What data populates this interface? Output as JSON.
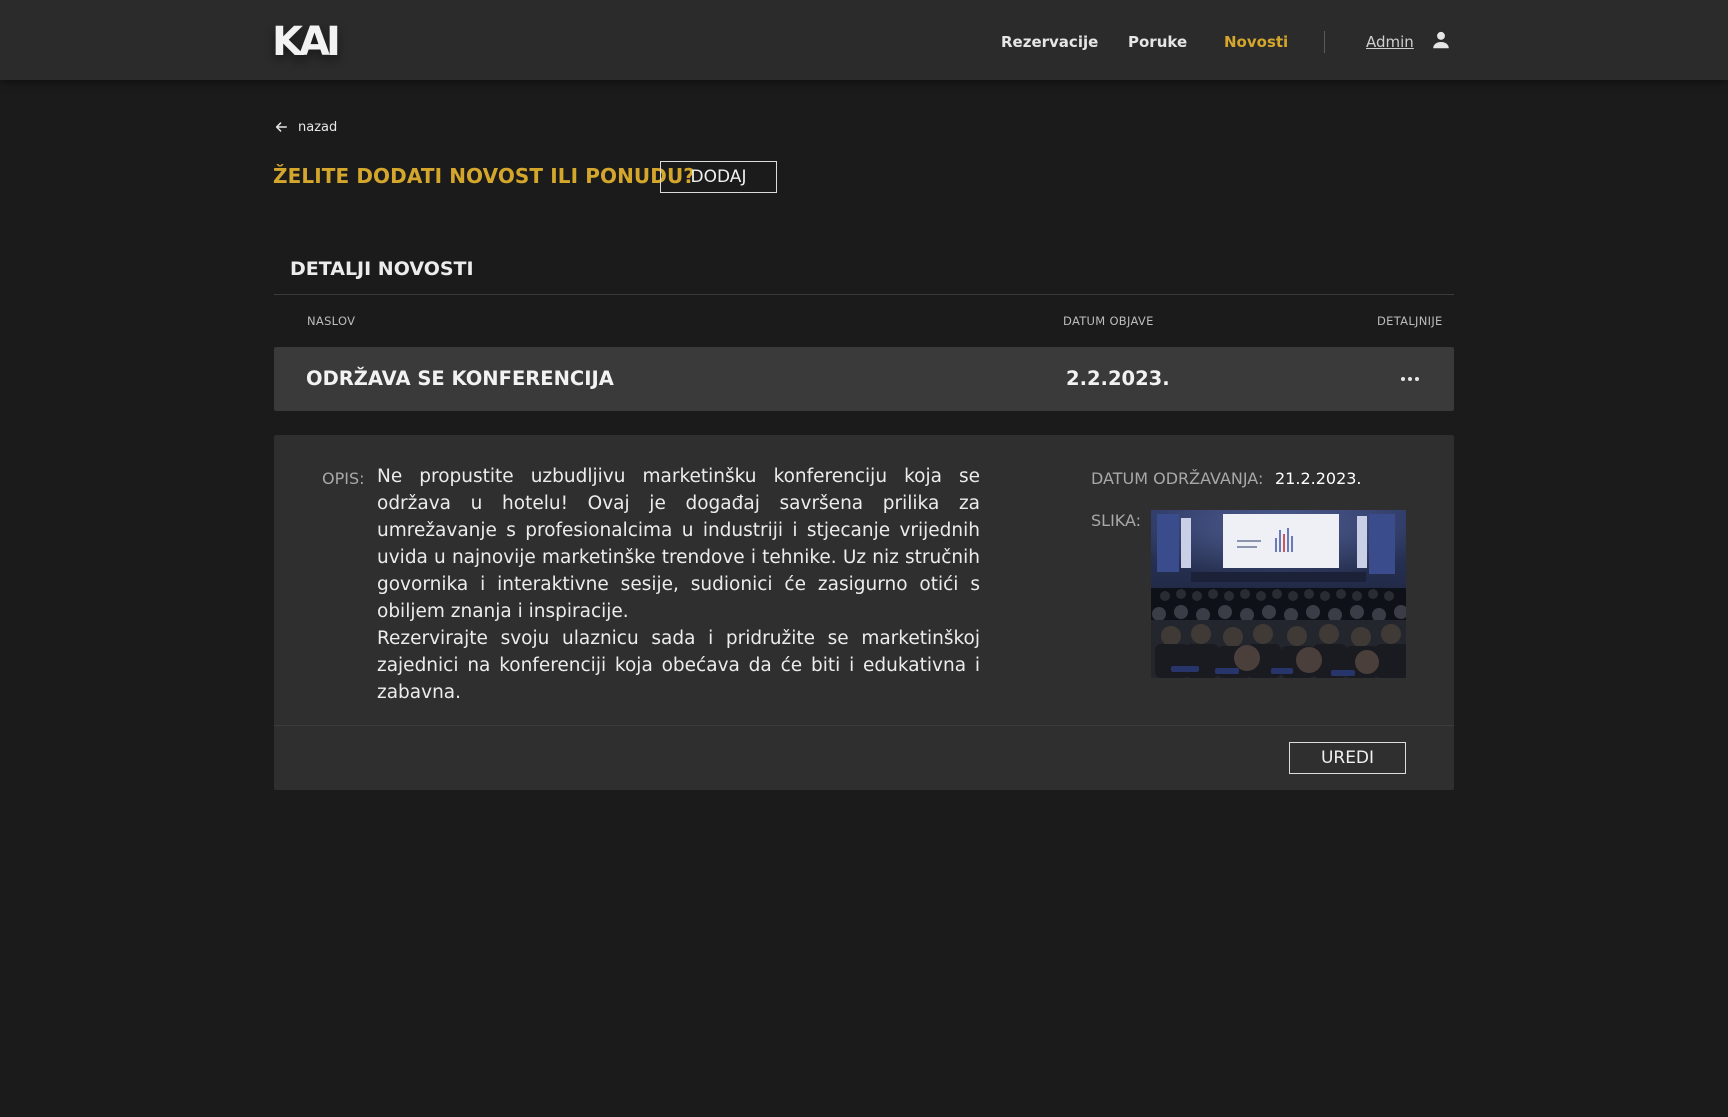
{
  "header": {
    "logo": "KAI",
    "nav": [
      {
        "label": "Rezervacije",
        "active": false
      },
      {
        "label": "Poruke",
        "active": false
      },
      {
        "label": "Novosti",
        "active": true
      }
    ],
    "user_label": "Admin",
    "user_icon": "person-icon"
  },
  "back_label": "nazad",
  "cta": {
    "question": "ŽELITE DODATI NOVOST ILI PONUDU?",
    "add_label": "DODAJ"
  },
  "section": {
    "title": "DETALJI NOVOSTI",
    "columns": [
      "NASLOV",
      "DATUM OBJAVE",
      "DETALJNIJE"
    ]
  },
  "news": {
    "title": "ODRŽAVA SE KONFERENCIJA",
    "published": "2.2.2023.",
    "description_label": "OPIS:",
    "description": [
      "Ne propustite uzbudljivu marketinšku konferenciju koja se održava u hotelu! Ovaj je događaj savršena prilika za umrežavanje s profesionalcima u industriji i stjecanje vrijednih uvida u najnovije marketinške trendove i tehnike. Uz niz stručnih govornika i interaktivne sesije, sudionici će zasigurno otići s obiljem znanja i inspiracije.",
      "Rezervirajte svoju ulaznicu sada i pridružite se marketinškoj zajednici na konferenciji koja obećava da će biti i edukativna i zabavna."
    ],
    "event_date_label": "DATUM ODRŽAVANJA:",
    "event_date": "21.2.2023.",
    "image_label": "SLIKA:",
    "edit_label": "UREDI"
  },
  "colors": {
    "accent": "#d4a72c",
    "background": "#1b1b1b",
    "header": "#2b2b2b",
    "row": "#3a3a3a",
    "panel": "#2f2f2f"
  }
}
